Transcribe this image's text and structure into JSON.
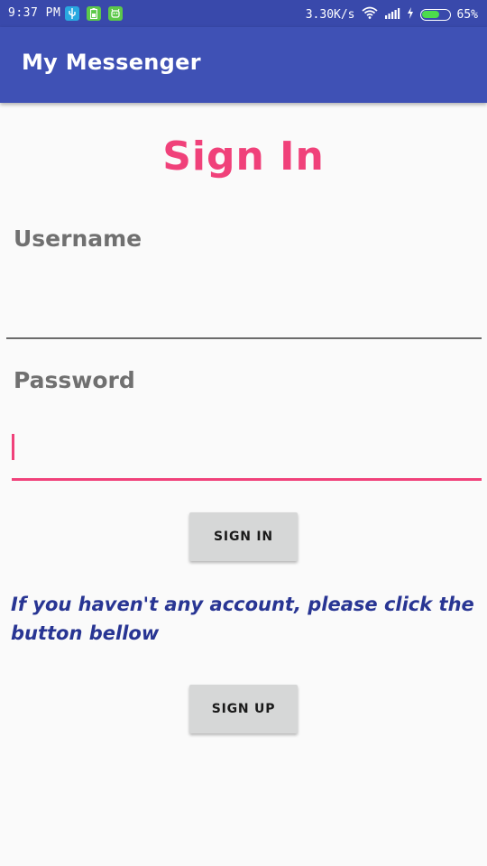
{
  "status_bar": {
    "time": "9:37 PM",
    "network_speed": "3.30K/s",
    "battery_percent": "65%",
    "battery_level": 0.65,
    "notification_icons": [
      "usb-icon",
      "battery-saver-icon",
      "android-icon"
    ],
    "colors": {
      "usb": "#29a8e0",
      "battery_saver": "#5cc84a",
      "android": "#5cc84a"
    }
  },
  "app_bar": {
    "title": "My Messenger"
  },
  "page": {
    "title": "Sign In"
  },
  "username": {
    "label": "Username",
    "value": ""
  },
  "password": {
    "label": "Password",
    "value": ""
  },
  "buttons": {
    "sign_in": "SIGN IN",
    "sign_up": "SIGN UP"
  },
  "info": {
    "text": "If you haven't any account, please click the button bellow"
  },
  "colors": {
    "primary": "#3f51b5",
    "primary_dark": "#3949ab",
    "accent": "#f0417a",
    "info_text": "#283593"
  }
}
